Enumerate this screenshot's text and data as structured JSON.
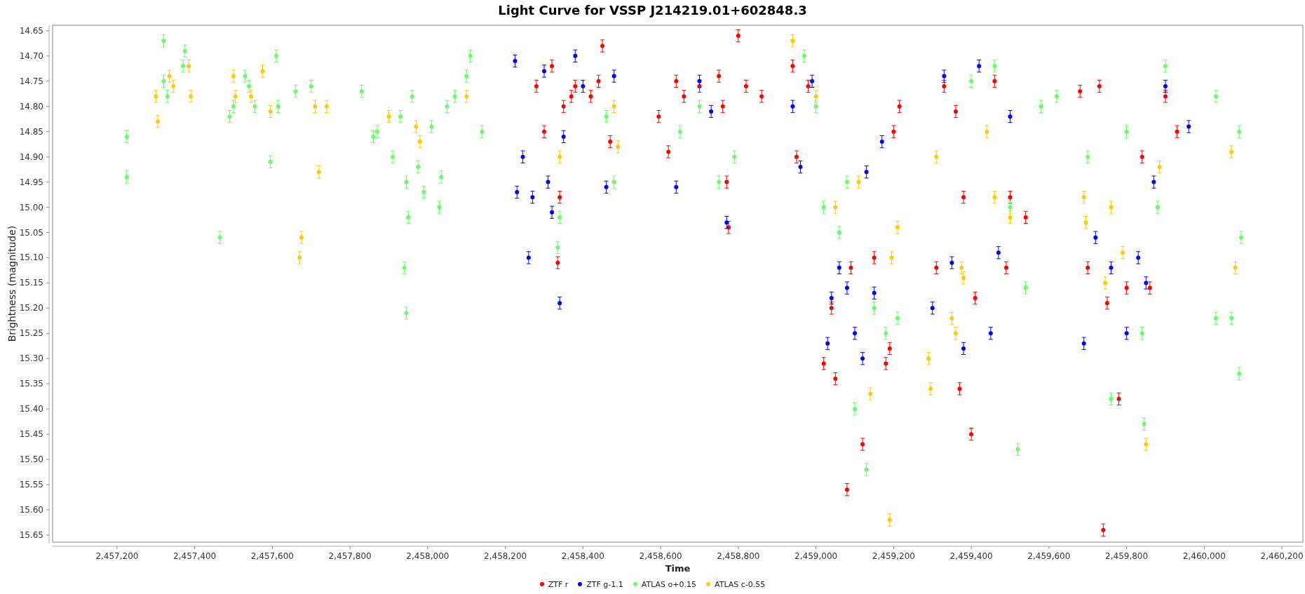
{
  "chart_data": {
    "type": "scatter",
    "title": "Light Curve for VSSP J214219.01+602848.3",
    "xlabel": "Time",
    "ylabel": "Brightness (magnitude)",
    "xlim": [
      2457034,
      2460254
    ],
    "ylim": [
      15.664,
      14.639
    ],
    "xticks": [
      {
        "value": 2457200,
        "label": "2,457,200"
      },
      {
        "value": 2457400,
        "label": "2,457,400"
      },
      {
        "value": 2457600,
        "label": "2,457,600"
      },
      {
        "value": 2457800,
        "label": "2,457,800"
      },
      {
        "value": 2458000,
        "label": "2,458,000"
      },
      {
        "value": 2458200,
        "label": "2,458,200"
      },
      {
        "value": 2458400,
        "label": "2,458,400"
      },
      {
        "value": 2458600,
        "label": "2,458,600"
      },
      {
        "value": 2458800,
        "label": "2,458,800"
      },
      {
        "value": 2459000,
        "label": "2,459,000"
      },
      {
        "value": 2459200,
        "label": "2,459,200"
      },
      {
        "value": 2459400,
        "label": "2,459,400"
      },
      {
        "value": 2459600,
        "label": "2,459,600"
      },
      {
        "value": 2459800,
        "label": "2,459,800"
      },
      {
        "value": 2460000,
        "label": "2,460,000"
      },
      {
        "value": 2460200,
        "label": "2,460,200"
      }
    ],
    "yticks": [
      {
        "value": 14.65,
        "label": "14.65"
      },
      {
        "value": 14.7,
        "label": "14.70"
      },
      {
        "value": 14.75,
        "label": "14.75"
      },
      {
        "value": 14.8,
        "label": "14.80"
      },
      {
        "value": 14.85,
        "label": "14.85"
      },
      {
        "value": 14.9,
        "label": "14.90"
      },
      {
        "value": 14.95,
        "label": "14.95"
      },
      {
        "value": 15.0,
        "label": "15.00"
      },
      {
        "value": 15.05,
        "label": "15.05"
      },
      {
        "value": 15.1,
        "label": "15.10"
      },
      {
        "value": 15.15,
        "label": "15.15"
      },
      {
        "value": 15.2,
        "label": "15.20"
      },
      {
        "value": 15.25,
        "label": "15.25"
      },
      {
        "value": 15.3,
        "label": "15.30"
      },
      {
        "value": 15.35,
        "label": "15.35"
      },
      {
        "value": 15.4,
        "label": "15.40"
      },
      {
        "value": 15.45,
        "label": "15.45"
      },
      {
        "value": 15.5,
        "label": "15.50"
      },
      {
        "value": 15.55,
        "label": "15.55"
      },
      {
        "value": 15.6,
        "label": "15.60"
      },
      {
        "value": 15.65,
        "label": "15.65"
      }
    ],
    "series": [
      {
        "name": "ZTF r",
        "color": "#ff0000",
        "errors": [
          0.012,
          0.012,
          0.012,
          0.012,
          0.012,
          0.012,
          0.012,
          0.012,
          0.012,
          0.012,
          0.012,
          0.012,
          0.012,
          0.012,
          0.012,
          0.012,
          0.012,
          0.012,
          0.012,
          0.012,
          0.012,
          0.012,
          0.012,
          0.012,
          0.012,
          0.012,
          0.012,
          0.012,
          0.012,
          0.012,
          0.012,
          0.012,
          0.012,
          0.012,
          0.012,
          0.012,
          0.012,
          0.012,
          0.012,
          0.012,
          0.012,
          0.012,
          0.012,
          0.012,
          0.012,
          0.012,
          0.012,
          0.012,
          0.012,
          0.012,
          0.012,
          0.012,
          0.012,
          0.012,
          0.012,
          0.012,
          0.012,
          0.012,
          0.012,
          0.012
        ],
        "x": [
          2458280,
          2458300,
          2458320,
          2458335,
          2458340,
          2458350,
          2458370,
          2458380,
          2458420,
          2458440,
          2458450,
          2458470,
          2458595,
          2458620,
          2458640,
          2458660,
          2458700,
          2458750,
          2458760,
          2458770,
          2458775,
          2458800,
          2458820,
          2458860,
          2458940,
          2458950,
          2458980,
          2459020,
          2459040,
          2459050,
          2459080,
          2459090,
          2459120,
          2459150,
          2459180,
          2459190,
          2459200,
          2459215,
          2459310,
          2459330,
          2459360,
          2459370,
          2459380,
          2459400,
          2459410,
          2459460,
          2459490,
          2459500,
          2459540,
          2459680,
          2459700,
          2459730,
          2459740,
          2459750,
          2459780,
          2459800,
          2459840,
          2459860,
          2459900,
          2459930
        ],
        "values": [
          14.76,
          14.85,
          14.72,
          15.11,
          14.98,
          14.8,
          14.78,
          14.76,
          14.78,
          14.75,
          14.68,
          14.87,
          14.82,
          14.89,
          14.75,
          14.78,
          14.76,
          14.74,
          14.8,
          14.95,
          15.04,
          14.66,
          14.76,
          14.78,
          14.72,
          14.9,
          14.76,
          15.31,
          15.2,
          15.34,
          15.56,
          15.12,
          15.47,
          15.1,
          15.31,
          15.28,
          14.85,
          14.8,
          15.12,
          14.76,
          14.81,
          15.36,
          14.98,
          15.45,
          15.18,
          14.75,
          15.12,
          14.98,
          15.02,
          14.77,
          15.12,
          14.76,
          15.64,
          15.19,
          15.38,
          15.16,
          14.9,
          15.16,
          14.78,
          14.85
        ]
      },
      {
        "name": "ZTF g-1.1",
        "color": "#0000ff",
        "errors": [
          0.012,
          0.012,
          0.012,
          0.012,
          0.012,
          0.012,
          0.012,
          0.012,
          0.012,
          0.012,
          0.012,
          0.012,
          0.012,
          0.012,
          0.012,
          0.012,
          0.012,
          0.012,
          0.012,
          0.012,
          0.012,
          0.012,
          0.012,
          0.012,
          0.012,
          0.012,
          0.012,
          0.012,
          0.012,
          0.012,
          0.012,
          0.012,
          0.012,
          0.012,
          0.012,
          0.012,
          0.012,
          0.012,
          0.012,
          0.012,
          0.012,
          0.012,
          0.012,
          0.012,
          0.012,
          0.012,
          0.012
        ],
        "x": [
          2458225,
          2458230,
          2458245,
          2458260,
          2458270,
          2458300,
          2458310,
          2458320,
          2458340,
          2458350,
          2458380,
          2458400,
          2458460,
          2458480,
          2458640,
          2458700,
          2458730,
          2458770,
          2458940,
          2458960,
          2458990,
          2459030,
          2459040,
          2459060,
          2459080,
          2459100,
          2459120,
          2459130,
          2459150,
          2459170,
          2459300,
          2459330,
          2459350,
          2459380,
          2459420,
          2459450,
          2459470,
          2459500,
          2459690,
          2459720,
          2459760,
          2459800,
          2459830,
          2459850,
          2459870,
          2459900,
          2459960
        ],
        "values": [
          14.71,
          14.97,
          14.9,
          15.1,
          14.98,
          14.73,
          14.95,
          15.01,
          15.19,
          14.86,
          14.7,
          14.76,
          14.96,
          14.74,
          14.96,
          14.75,
          14.81,
          15.03,
          14.8,
          14.92,
          14.75,
          15.27,
          15.18,
          15.12,
          15.16,
          15.25,
          15.3,
          14.93,
          15.17,
          14.87,
          15.2,
          14.74,
          15.11,
          15.28,
          14.72,
          15.25,
          15.09,
          14.82,
          15.27,
          15.06,
          15.12,
          15.25,
          15.1,
          15.15,
          14.95,
          14.76,
          14.84
        ]
      },
      {
        "name": "ATLAS o+0.15",
        "color": "#66ff66",
        "errors": [
          0.012,
          0.012,
          0.012,
          0.012,
          0.012,
          0.012,
          0.012,
          0.012,
          0.012,
          0.012,
          0.012,
          0.012,
          0.012,
          0.012,
          0.012,
          0.012,
          0.012,
          0.012,
          0.012,
          0.012,
          0.012,
          0.012,
          0.012,
          0.012,
          0.012,
          0.012,
          0.012,
          0.012,
          0.012,
          0.012,
          0.012,
          0.012,
          0.012,
          0.012,
          0.012,
          0.012,
          0.012,
          0.012,
          0.012,
          0.012,
          0.012,
          0.012,
          0.012,
          0.012,
          0.012,
          0.012,
          0.012,
          0.012,
          0.012,
          0.012,
          0.012,
          0.012,
          0.012,
          0.012,
          0.012,
          0.012,
          0.012,
          0.012,
          0.012,
          0.012,
          0.012,
          0.012,
          0.012,
          0.012,
          0.012,
          0.012,
          0.012,
          0.012,
          0.012,
          0.012,
          0.012,
          0.012,
          0.012,
          0.012,
          0.012,
          0.012
        ],
        "x": [
          2457225,
          2457225,
          2457320,
          2457320,
          2457330,
          2457370,
          2457375,
          2457465,
          2457490,
          2457500,
          2457530,
          2457540,
          2457555,
          2457595,
          2457610,
          2457615,
          2457660,
          2457700,
          2457830,
          2457860,
          2457870,
          2457910,
          2457930,
          2457940,
          2457945,
          2457945,
          2457950,
          2457960,
          2457975,
          2457990,
          2458010,
          2458030,
          2458035,
          2458050,
          2458070,
          2458100,
          2458110,
          2458140,
          2458335,
          2458340,
          2458460,
          2458480,
          2458650,
          2458700,
          2458750,
          2458790,
          2458970,
          2459000,
          2459020,
          2459060,
          2459080,
          2459100,
          2459130,
          2459150,
          2459180,
          2459210,
          2459400,
          2459460,
          2459500,
          2459520,
          2459540,
          2459580,
          2459620,
          2459700,
          2459760,
          2459800,
          2459840,
          2459845,
          2459880,
          2459900,
          2460030,
          2460030,
          2460070,
          2460090,
          2460090,
          2460095
        ],
        "values": [
          14.86,
          14.94,
          14.67,
          14.75,
          14.78,
          14.72,
          14.69,
          15.06,
          14.82,
          14.8,
          14.74,
          14.76,
          14.8,
          14.91,
          14.7,
          14.8,
          14.77,
          14.76,
          14.77,
          14.86,
          14.85,
          14.9,
          14.82,
          15.12,
          15.21,
          14.95,
          15.02,
          14.78,
          14.92,
          14.97,
          14.84,
          15.0,
          14.94,
          14.8,
          14.78,
          14.74,
          14.7,
          14.85,
          15.08,
          15.02,
          14.82,
          14.95,
          14.85,
          14.8,
          14.95,
          14.9,
          14.7,
          14.8,
          15.0,
          15.05,
          14.95,
          15.4,
          15.52,
          15.2,
          15.25,
          15.22,
          14.75,
          14.72,
          15.0,
          15.48,
          15.16,
          14.8,
          14.78,
          14.9,
          15.38,
          14.85,
          15.25,
          15.43,
          15.0,
          14.72,
          14.78,
          15.22,
          15.22,
          15.33,
          14.85,
          15.06
        ]
      },
      {
        "name": "ATLAS c-0.55",
        "color": "#ffcc00",
        "errors": [
          0.012,
          0.012,
          0.012,
          0.012,
          0.012,
          0.012,
          0.012,
          0.012,
          0.012,
          0.012,
          0.012,
          0.012,
          0.012,
          0.012,
          0.012,
          0.012,
          0.012,
          0.012,
          0.012,
          0.012,
          0.012,
          0.012,
          0.012,
          0.012,
          0.012,
          0.012,
          0.012,
          0.012,
          0.012,
          0.012,
          0.012,
          0.012,
          0.012,
          0.012,
          0.012,
          0.012,
          0.012,
          0.012,
          0.012,
          0.012,
          0.012,
          0.012,
          0.012,
          0.012,
          0.012,
          0.012,
          0.012,
          0.012,
          0.012,
          0.012
        ],
        "x": [
          2457300,
          2457305,
          2457335,
          2457345,
          2457385,
          2457390,
          2457500,
          2457505,
          2457545,
          2457575,
          2457595,
          2457670,
          2457675,
          2457710,
          2457720,
          2457740,
          2457900,
          2457970,
          2457980,
          2458100,
          2458340,
          2458480,
          2458490,
          2458940,
          2459000,
          2459050,
          2459110,
          2459140,
          2459190,
          2459195,
          2459210,
          2459290,
          2459295,
          2459310,
          2459350,
          2459360,
          2459375,
          2459380,
          2459440,
          2459460,
          2459500,
          2459690,
          2459695,
          2459745,
          2459760,
          2459790,
          2459850,
          2459885,
          2460070,
          2460080
        ],
        "values": [
          14.78,
          14.83,
          14.74,
          14.76,
          14.72,
          14.78,
          14.74,
          14.78,
          14.78,
          14.73,
          14.81,
          15.1,
          15.06,
          14.8,
          14.93,
          14.8,
          14.82,
          14.84,
          14.87,
          14.78,
          14.9,
          14.8,
          14.88,
          14.67,
          14.78,
          15.0,
          14.95,
          15.37,
          15.62,
          15.1,
          15.04,
          15.3,
          15.36,
          14.9,
          15.22,
          15.25,
          15.12,
          15.14,
          14.85,
          14.98,
          15.02,
          14.98,
          15.03,
          15.15,
          15.0,
          15.09,
          15.47,
          14.92,
          14.89,
          15.12
        ]
      }
    ]
  }
}
